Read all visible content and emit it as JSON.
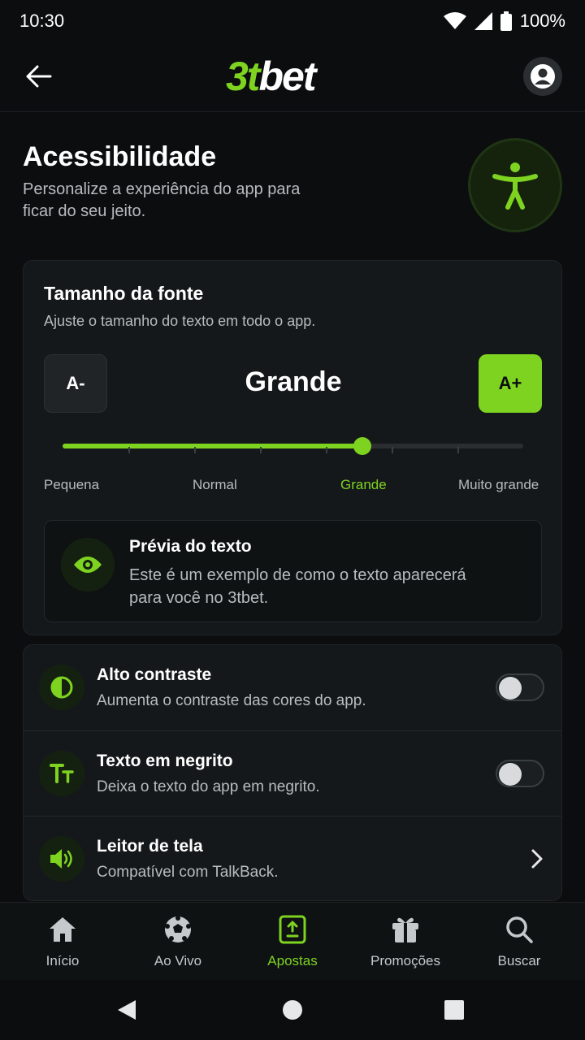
{
  "status_bar": {
    "time": "10:30",
    "battery": "100%"
  },
  "app_bar": {
    "logo_part1": "3t",
    "logo_part2": "bet"
  },
  "page": {
    "title": "Acessibilidade",
    "subtitle": "Personalize a experiência do app para ficar do seu jeito."
  },
  "font_size": {
    "title": "Tamanho da fonte",
    "subtitle": "Ajuste o tamanho do texto em todo o app.",
    "decrease_label": "A-",
    "increase_label": "A+",
    "current_value": "Grande",
    "slider_level": 0.65,
    "levels": [
      "Pequena",
      "Normal",
      "Grande",
      "Muito grande"
    ],
    "active_level": "Grande"
  },
  "preview": {
    "title": "Prévia do texto",
    "body": "Este é um exemplo de como o texto aparecerá para você no 3tbet."
  },
  "options": [
    {
      "title": "Alto contraste",
      "subtitle": "Aumenta o contraste das cores do app.",
      "control": "toggle",
      "enabled": false,
      "icon": "contrast-icon"
    },
    {
      "title": "Texto em negrito",
      "subtitle": "Deixa o texto do app em negrito.",
      "control": "toggle",
      "enabled": false,
      "icon": "text-size-icon"
    },
    {
      "title": "Leitor de tela",
      "subtitle": "Compatível com TalkBack.",
      "control": "chevron",
      "icon": "speaker-icon"
    }
  ],
  "bottom_nav": [
    {
      "label": "Início",
      "icon": "home-icon",
      "active": false
    },
    {
      "label": "Ao Vivo",
      "icon": "soccer-ball-icon",
      "active": false
    },
    {
      "label": "Apostas",
      "icon": "bet-slip-icon",
      "active": true
    },
    {
      "label": "Promoções",
      "icon": "gift-icon",
      "active": false
    },
    {
      "label": "Buscar",
      "icon": "search-icon",
      "active": false
    }
  ],
  "colors": {
    "accent": "#7ed321",
    "background": "#0b0d0e",
    "card": "#15181a"
  }
}
